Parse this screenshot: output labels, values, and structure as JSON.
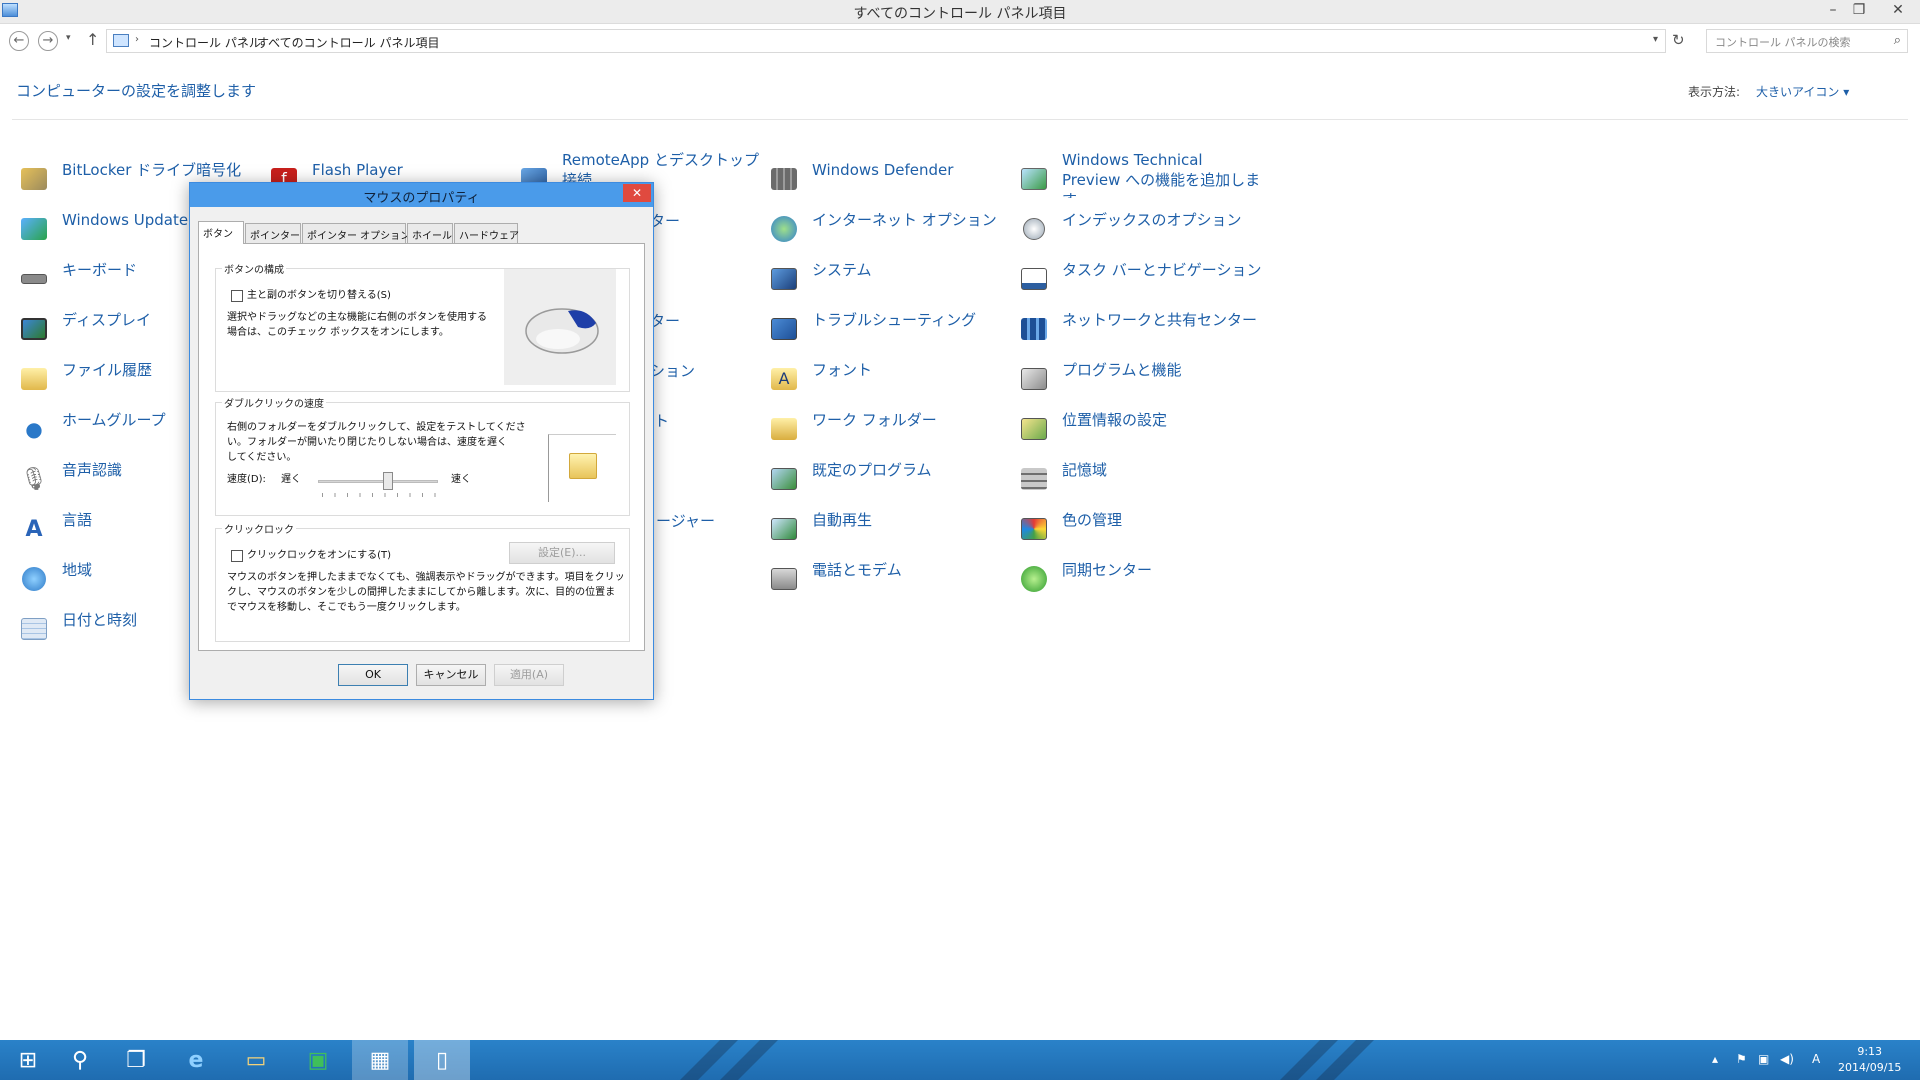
{
  "window": {
    "title": "すべてのコントロール パネル項目",
    "min": "–",
    "max": "❐",
    "close": "✕"
  },
  "address": {
    "back": "←",
    "forward": "→",
    "recent": "▾",
    "up": "↑",
    "crumbs": [
      "コントロール パネル",
      "すべてのコントロール パネル項目"
    ],
    "separator": "›",
    "dropdown": "▾",
    "refresh": "↻",
    "search_placeholder": "コントロール パネルの検索",
    "search_icon": "⌕"
  },
  "header": {
    "title": "コンピューターの設定を調整します",
    "view_label": "表示方法:",
    "view_value": "大きいアイコン ▾"
  },
  "items": {
    "col1": [
      "BitLocker ドライブ暗号化",
      "Windows Update",
      "キーボード",
      "ディスプレイ",
      "ファイル履歴",
      "ホームグループ",
      "音声認識",
      "言語",
      "地域",
      "日付と時刻"
    ],
    "col2": [
      "Flash Player"
    ],
    "col3": [
      "RemoteApp とデスクトップ接続",
      "ター",
      "ター",
      "ション",
      "ト",
      "ージャー"
    ],
    "col4": [
      "Windows Defender",
      "インターネット オプション",
      "システム",
      "トラブルシューティング",
      "フォント",
      "ワーク フォルダー",
      "既定のプログラム",
      "自動再生",
      "電話とモデム"
    ],
    "col5": [
      "Windows Technical Preview への機能を追加します",
      "インデックスのオプション",
      "タスク バーとナビゲーション",
      "ネットワークと共有センター",
      "プログラムと機能",
      "位置情報の設定",
      "記憶域",
      "色の管理",
      "同期センター"
    ]
  },
  "dialog": {
    "title": "マウスのプロパティ",
    "close": "✕",
    "tabs": [
      "ボタン",
      "ポインター",
      "ポインター オプション",
      "ホイール",
      "ハードウェア"
    ],
    "button_config": {
      "group_title": "ボタンの構成",
      "checkbox_label": "主と副のボタンを切り替える(S)",
      "desc1": "選択やドラッグなどの主な機能に右側のボタンを使用する",
      "desc2": "場合は、このチェック ボックスをオンにします。"
    },
    "double_click": {
      "group_title": "ダブルクリックの速度",
      "desc1": "右側のフォルダーをダブルクリックして、設定をテストしてくださ",
      "desc2": "い。フォルダーが開いたり閉じたりしない場合は、速度を遅く",
      "desc3": "してください。",
      "speed_label": "速度(D):",
      "slow": "遅く",
      "fast": "速く",
      "speed_level": 0.58
    },
    "click_lock": {
      "group_title": "クリックロック",
      "checkbox_label": "クリックロックをオンにする(T)",
      "settings_button": "設定(E)...",
      "desc1": "マウスのボタンを押したままでなくても、強調表示やドラッグができます。項目をクリッ",
      "desc2": "クし、マウスのボタンを少しの間押したままにしてから離します。次に、目的の位置ま",
      "desc3": "でマウスを移動し、そこでもう一度クリックします。"
    },
    "ok": "OK",
    "cancel": "キャンセル",
    "apply": "適用(A)"
  },
  "taskbar": {
    "start": "⊞",
    "search": "⚲",
    "taskview": "❐",
    "ie": "e",
    "explorer": "▭",
    "store": "▣",
    "controlpanel": "▦",
    "notepad": "▯",
    "tray_icons": [
      "▴",
      "⚑",
      "▣",
      "◀)",
      "A"
    ],
    "time": "9:13",
    "date": "2014/09/15"
  }
}
